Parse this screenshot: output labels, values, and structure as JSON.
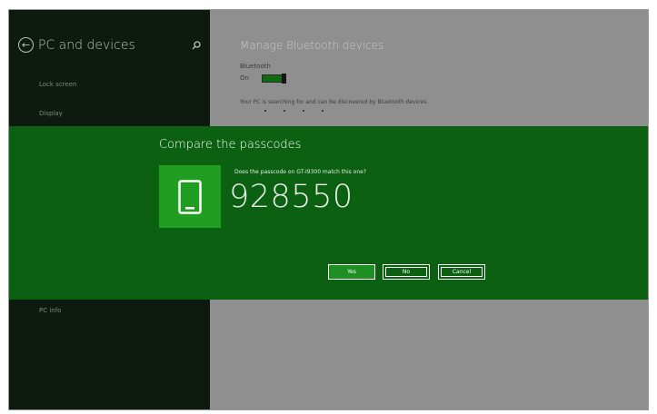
{
  "sidebar": {
    "title": "PC and devices",
    "back_icon": "back-arrow-icon",
    "search_icon": "search-icon",
    "items": [
      {
        "label": "Lock screen"
      },
      {
        "label": "Display"
      },
      {
        "label": "PC info"
      }
    ]
  },
  "content": {
    "title": "Manage Bluetooth devices",
    "bluetooth_label": "Bluetooth",
    "bluetooth_state": "On",
    "bluetooth_on": true,
    "status_text": "Your PC is searching for and can be discovered by Bluetooth devices."
  },
  "dialog": {
    "title": "Compare the passcodes",
    "question": "Does the passcode on GT-I9300 match this one?",
    "passcode": "928550",
    "device_icon": "phone-icon",
    "buttons": {
      "yes": "Yes",
      "no": "No",
      "cancel": "Cancel"
    }
  },
  "colors": {
    "dialog_bg": "#0b6011",
    "accent": "#1f9e22",
    "sidebar_bg": "#0e1a10",
    "content_bg": "#8f8f8f"
  }
}
